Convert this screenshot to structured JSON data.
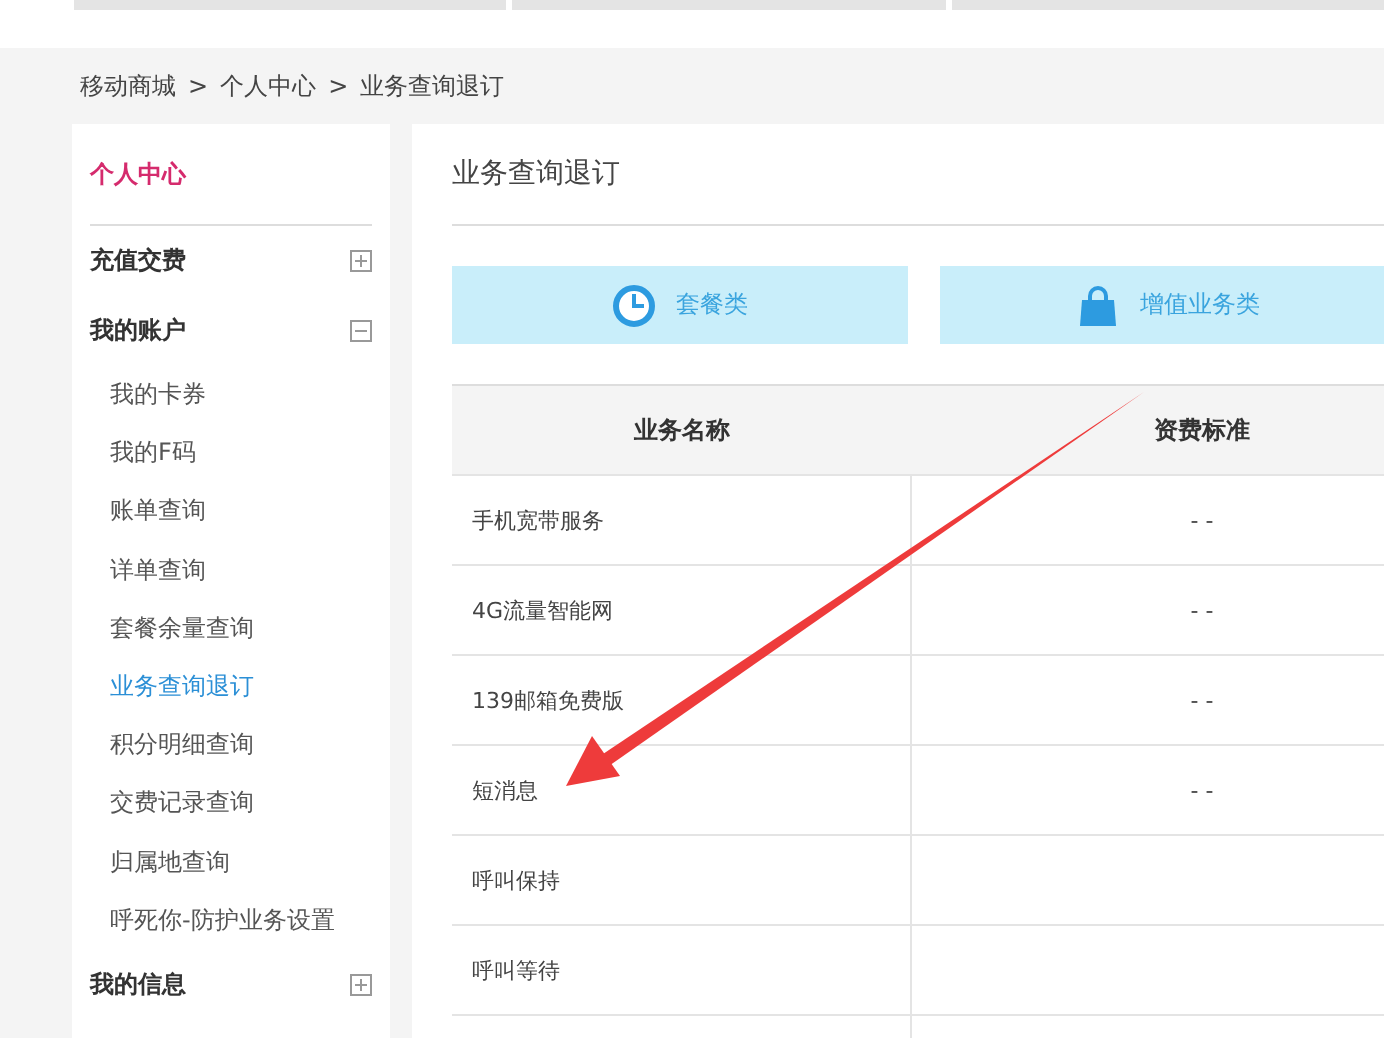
{
  "breadcrumb": [
    "移动商城",
    "个人中心",
    "业务查询退订"
  ],
  "breadcrumb_separator": ">",
  "sidebar": {
    "title": "个人中心",
    "groups": [
      {
        "label": "充值交费",
        "expanded": false
      },
      {
        "label": "我的账户",
        "expanded": true,
        "children": [
          {
            "label": "我的卡券",
            "selected": false
          },
          {
            "label": "我的F码",
            "selected": false
          },
          {
            "label": "账单查询",
            "selected": false
          },
          {
            "label": "详单查询",
            "selected": false
          },
          {
            "label": "套餐余量查询",
            "selected": false
          },
          {
            "label": "业务查询退订",
            "selected": true
          },
          {
            "label": "积分明细查询",
            "selected": false
          },
          {
            "label": "交费记录查询",
            "selected": false
          },
          {
            "label": "归属地查询",
            "selected": false
          },
          {
            "label": "呼死你-防护业务设置",
            "selected": false
          }
        ]
      },
      {
        "label": "我的信息",
        "expanded": false
      }
    ]
  },
  "main": {
    "title": "业务查询退订",
    "categories": [
      {
        "kind": "clock",
        "label": "套餐类"
      },
      {
        "kind": "bag",
        "label": "增值业务类"
      }
    ],
    "table": {
      "columns": [
        "业务名称",
        "资费标准"
      ],
      "rows": [
        {
          "name": "手机宽带服务",
          "fee": "- -"
        },
        {
          "name": "4G流量智能网",
          "fee": "- -"
        },
        {
          "name": "139邮箱免费版",
          "fee": "- -"
        },
        {
          "name": "短消息",
          "fee": "- -"
        },
        {
          "name": "呼叫保持"
        },
        {
          "name": "呼叫等待"
        },
        {}
      ]
    }
  },
  "annotation": {
    "kind": "arrow",
    "color": "#ee3b3b"
  }
}
